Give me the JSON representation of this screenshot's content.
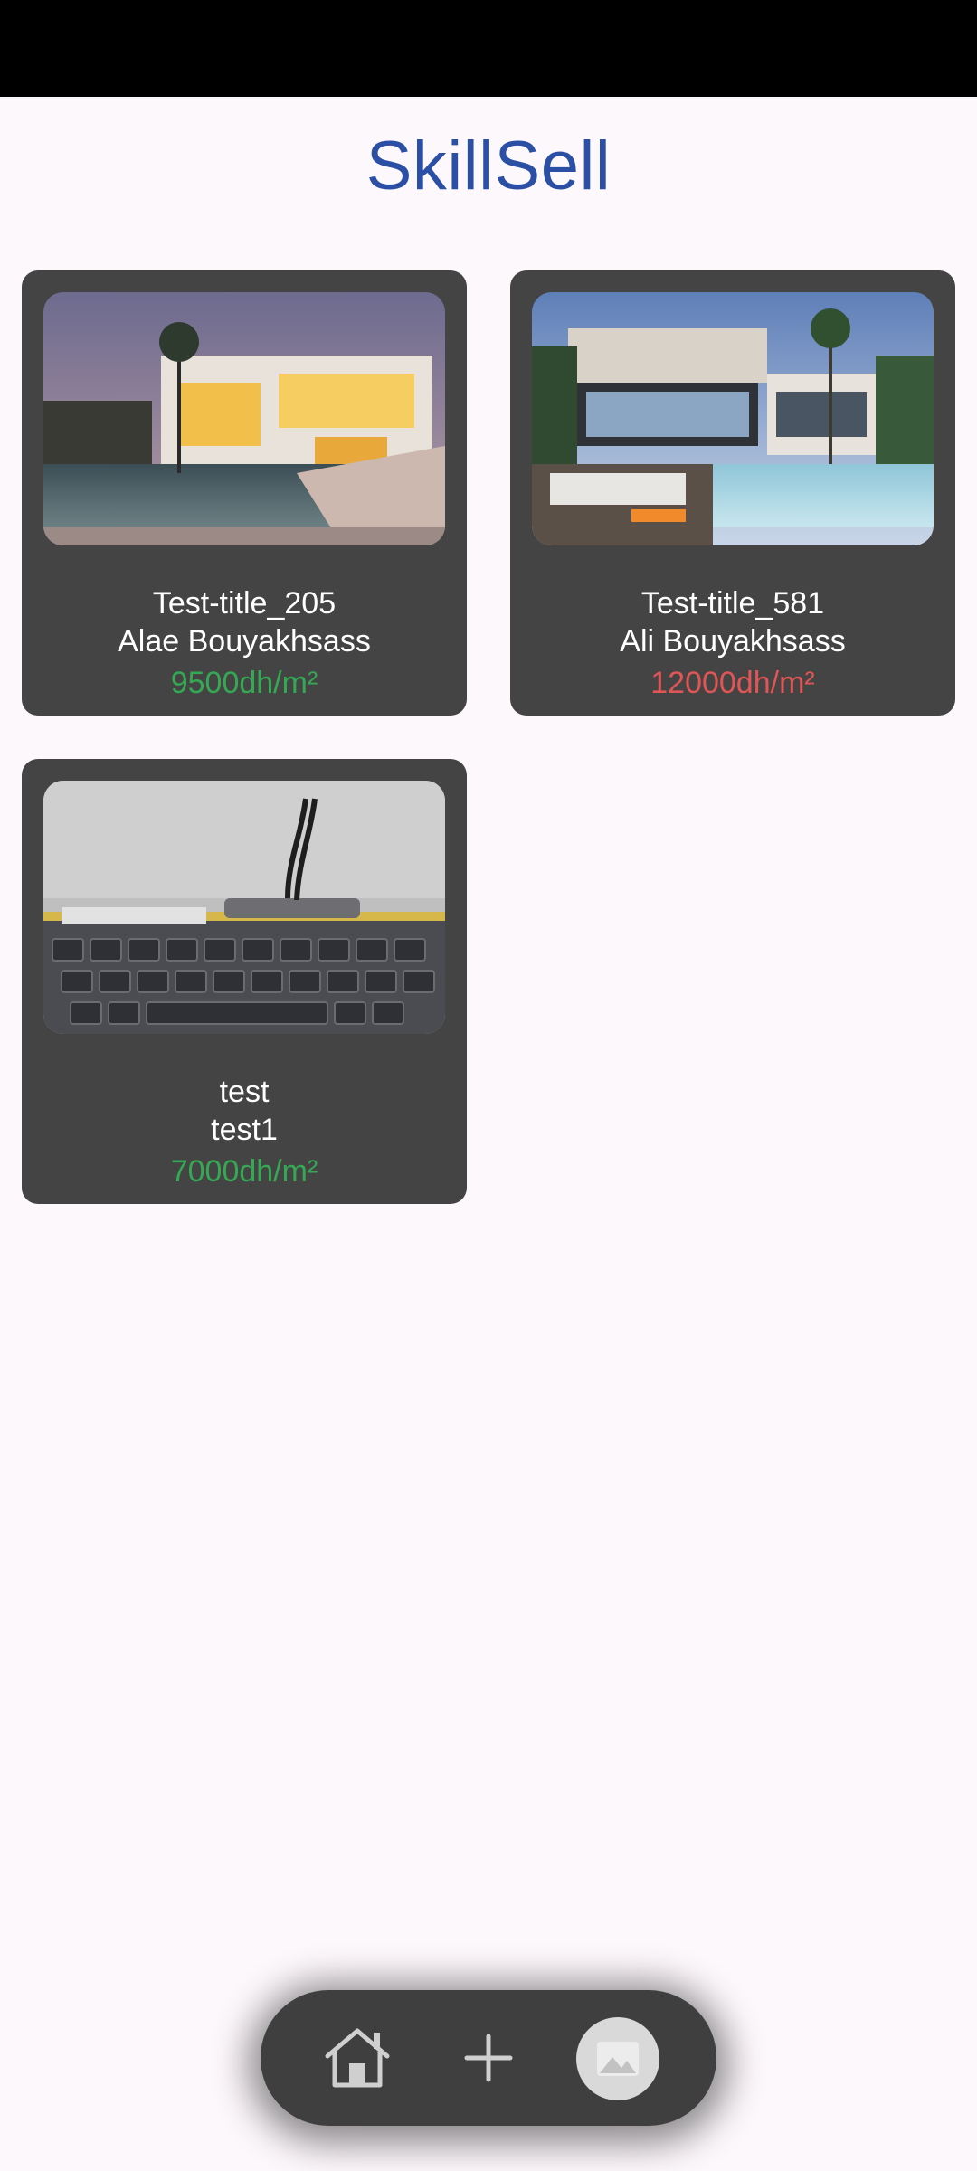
{
  "app": {
    "title": "SkillSell"
  },
  "listings": [
    {
      "title": "Test-title_205",
      "owner": "Alae Bouyakhsass",
      "price": "9500dh/m²",
      "price_color": "#35a853",
      "image": "modern-villa-dusk-photo"
    },
    {
      "title": "Test-title_581",
      "owner": "Ali Bouyakhsass",
      "price": "12000dh/m²",
      "price_color": "#e05555",
      "image": "luxury-villa-pool-photo"
    },
    {
      "title": "test",
      "owner": "test1",
      "price": "7000dh/m²",
      "price_color": "#35a853",
      "image": "keyboard-usb-hub-photo"
    }
  ],
  "nav": {
    "items": [
      {
        "icon": "home-icon"
      },
      {
        "icon": "plus-icon"
      },
      {
        "icon": "profile-image-placeholder-icon"
      }
    ]
  },
  "colors": {
    "accent": "#2c4fa6",
    "card": "#444444",
    "background": "#fdf8fc"
  }
}
